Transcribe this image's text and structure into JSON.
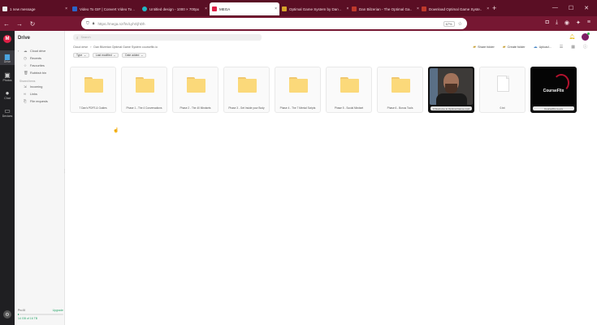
{
  "browser": {
    "tabs": [
      {
        "title": "1 new message",
        "color": "#e8e8e8",
        "active": false
      },
      {
        "title": "Video To GIF | Convert Video To ..",
        "color": "#2c64c8",
        "active": false
      },
      {
        "title": "Untitled design - 1000 × 700px",
        "color": "#22b6c4",
        "active": false
      },
      {
        "title": "MEGA",
        "color": "#dd1f45",
        "active": true
      },
      {
        "title": "Optimal Game System by Dan ..",
        "color": "#d8a32a",
        "active": false
      },
      {
        "title": "Dan Bilzerian - The Optimal Ga..",
        "color": "#c0392b",
        "active": false
      },
      {
        "title": "Download Optimal Game Syste..",
        "color": "#c0392b",
        "active": false
      }
    ],
    "new_tab": "+",
    "url": "https://mega.nz/fm/LyhGjhDh",
    "zoom": "67%"
  },
  "rail": {
    "logo": "M",
    "items": [
      {
        "label": "Drive",
        "icon": "folder-icon",
        "active": true
      },
      {
        "label": "Photos",
        "icon": "photos-icon",
        "active": false
      },
      {
        "label": "Chat",
        "icon": "chat-icon",
        "active": false
      },
      {
        "label": "Devices",
        "icon": "devices-icon",
        "active": false
      }
    ]
  },
  "sidebar": {
    "title": "Drive",
    "items": [
      {
        "label": "Cloud drive",
        "icon": "cloud-icon"
      },
      {
        "label": "Recents",
        "icon": "clock-icon"
      },
      {
        "label": "Favourites",
        "icon": "star-icon"
      },
      {
        "label": "Rubbish bin",
        "icon": "trash-icon"
      }
    ],
    "section": "Shared items",
    "shared_items": [
      {
        "label": "Incoming",
        "icon": "incoming-icon"
      },
      {
        "label": "Links",
        "icon": "link-icon"
      },
      {
        "label": "File requests",
        "icon": "file-request-icon"
      }
    ],
    "storage": {
      "plan": "Pro III",
      "upgrade": "Upgrade",
      "used": "14 GB of 16 TB",
      "fraction": 0.01
    }
  },
  "main": {
    "search_placeholder": "Search",
    "breadcrumb": [
      "Cloud drive",
      "›",
      "Dan Bilzerian Optimal Game System courseflix.io"
    ],
    "actions": {
      "share": "Share folder",
      "create": "Create folder",
      "upload": "Upload..."
    },
    "filters": [
      "Type",
      "Last modified",
      "Date added"
    ],
    "items": [
      {
        "name": "7 Dan's PDFS & Guides",
        "kind": "folder"
      },
      {
        "name": "Phase 1 - The 4 Conversations",
        "kind": "folder"
      },
      {
        "name": "Phase 2 - The 40 Mindsets",
        "kind": "folder"
      },
      {
        "name": "Phase 3 - Get Inside your Body",
        "kind": "folder"
      },
      {
        "name": "Phase 4 - The 7 Mental Scripts",
        "kind": "folder"
      },
      {
        "name": "Phase 5 - Social Mindset",
        "kind": "folder"
      },
      {
        "name": "Phase 6 - Bonus Tools",
        "kind": "folder"
      },
      {
        "name": "0 Welcome to Optimal Game.mp4",
        "kind": "video"
      },
      {
        "name": "0.txt",
        "kind": "document"
      },
      {
        "name": "CourseFlix.io.ecs",
        "kind": "image",
        "brand": "CourseFlix"
      }
    ]
  }
}
